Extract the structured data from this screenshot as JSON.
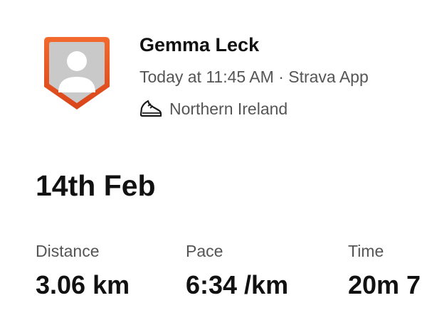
{
  "header": {
    "athlete_name": "Gemma Leck",
    "timestamp_source": "Today at 11:45 AM · Strava App",
    "location": "Northern Ireland",
    "avatar_icon": "default-avatar-icon",
    "activity_icon": "running-shoe-icon",
    "avatar_border_color": "#e8501e"
  },
  "activity": {
    "title": "14th Feb"
  },
  "stats": {
    "distance": {
      "label": "Distance",
      "value": "3.06 km"
    },
    "pace": {
      "label": "Pace",
      "value": "6:34 /km"
    },
    "time": {
      "label": "Time",
      "value": "20m 7"
    }
  }
}
